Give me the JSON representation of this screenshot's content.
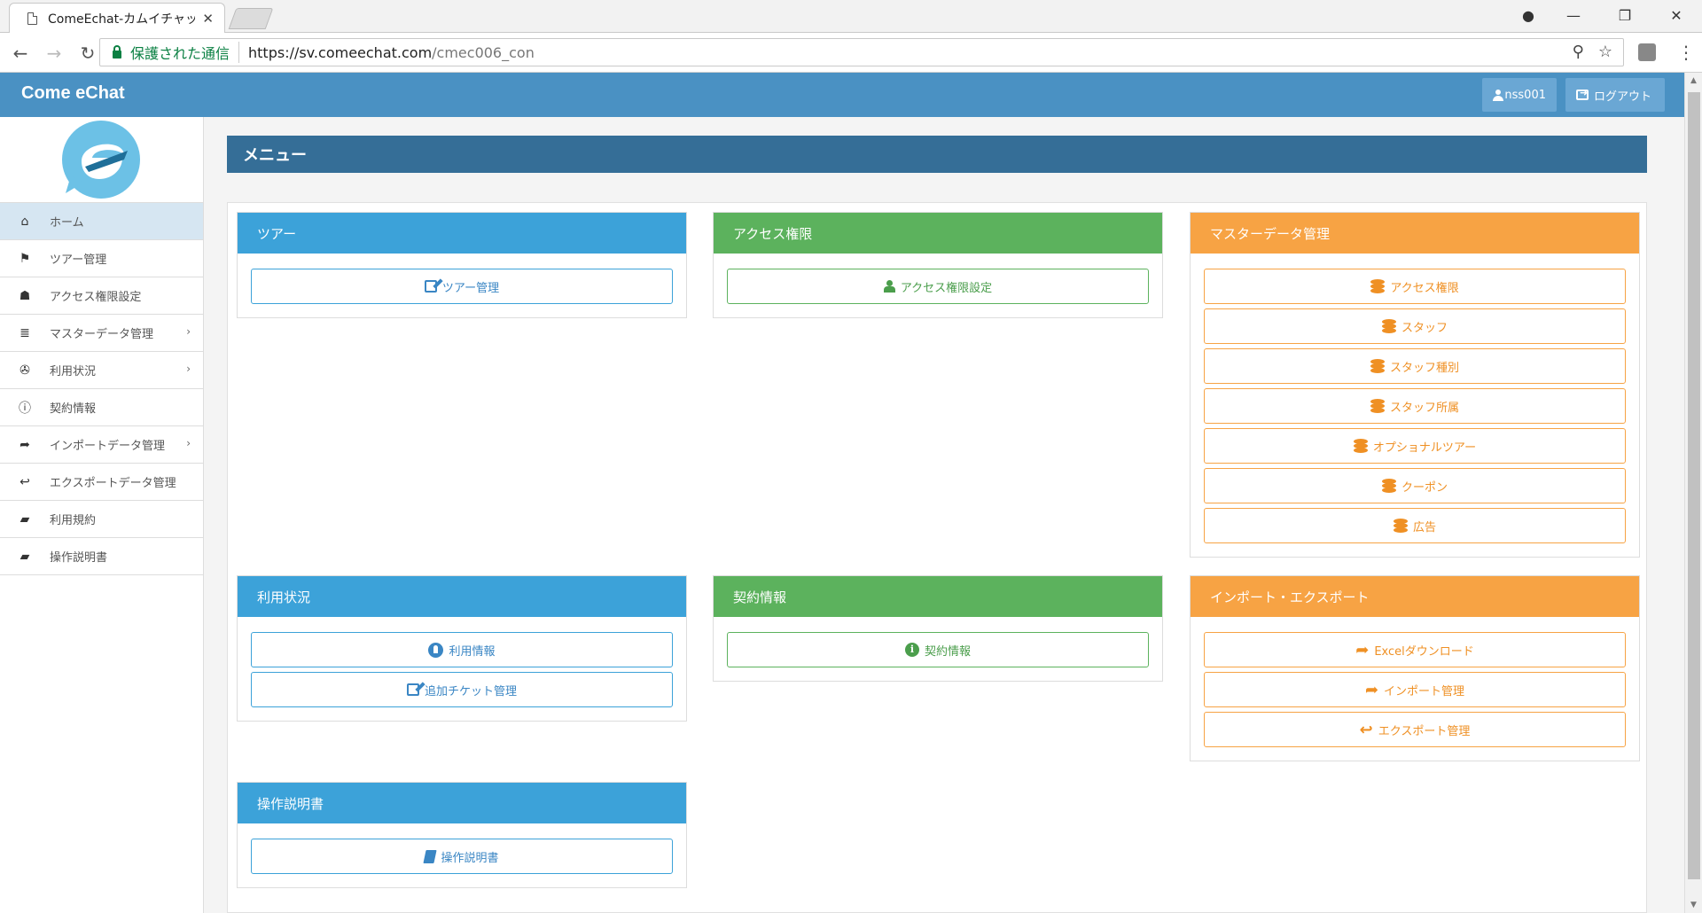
{
  "browser": {
    "tab_title": "ComeEchat-カムイチャット",
    "secure_label": "保護された通信",
    "url_host": "https://sv.comeechat.com",
    "url_path": "/cmec006_con"
  },
  "header": {
    "brand": "Come eChat",
    "username": "nss001",
    "logout_label": "ログアウト"
  },
  "sidebar": {
    "items": [
      {
        "label": "ホーム",
        "icon": "home-icon",
        "glyph": "⌂",
        "active": true,
        "submenu": false
      },
      {
        "label": "ツアー管理",
        "icon": "flag-icon",
        "glyph": "⚑",
        "active": false,
        "submenu": false
      },
      {
        "label": "アクセス権限設定",
        "icon": "user-secret-icon",
        "glyph": "☗",
        "active": false,
        "submenu": false
      },
      {
        "label": "マスターデータ管理",
        "icon": "database-icon",
        "glyph": "≣",
        "active": false,
        "submenu": true
      },
      {
        "label": "利用状況",
        "icon": "rebel-icon",
        "glyph": "✇",
        "active": false,
        "submenu": true
      },
      {
        "label": "契約情報",
        "icon": "info-icon",
        "glyph": "ⓘ",
        "active": false,
        "submenu": false
      },
      {
        "label": "インポートデータ管理",
        "icon": "share-icon",
        "glyph": "➦",
        "active": false,
        "submenu": true
      },
      {
        "label": "エクスポートデータ管理",
        "icon": "reply-icon",
        "glyph": "↩",
        "active": false,
        "submenu": false
      },
      {
        "label": "利用規約",
        "icon": "book-icon",
        "glyph": "▰",
        "active": false,
        "submenu": false
      },
      {
        "label": "操作説明書",
        "icon": "book-icon",
        "glyph": "▰",
        "active": false,
        "submenu": false
      }
    ]
  },
  "main": {
    "page_title": "メニュー",
    "cards": {
      "tour": {
        "title": "ツアー",
        "buttons": [
          "ツアー管理"
        ]
      },
      "access": {
        "title": "アクセス権限",
        "buttons": [
          "アクセス権限設定"
        ]
      },
      "master": {
        "title": "マスターデータ管理",
        "buttons": [
          "アクセス権限",
          "スタッフ",
          "スタッフ種別",
          "スタッフ所属",
          "オプショナルツアー",
          "クーポン",
          "広告"
        ]
      },
      "usage": {
        "title": "利用状況",
        "buttons": [
          "利用情報",
          "追加チケット管理"
        ]
      },
      "contract": {
        "title": "契約情報",
        "buttons": [
          "契約情報"
        ]
      },
      "io": {
        "title": "インポート・エクスポート",
        "buttons": [
          "Excelダウンロード",
          "インポート管理",
          "エクスポート管理"
        ]
      },
      "manual": {
        "title": "操作説明書",
        "buttons": [
          "操作説明書"
        ]
      }
    }
  },
  "colors": {
    "header_blue": "#4a91c3",
    "title_bar": "#356e97",
    "card_blue": "#3ca2d9",
    "card_green": "#5cb25d",
    "card_orange": "#f7a344"
  }
}
